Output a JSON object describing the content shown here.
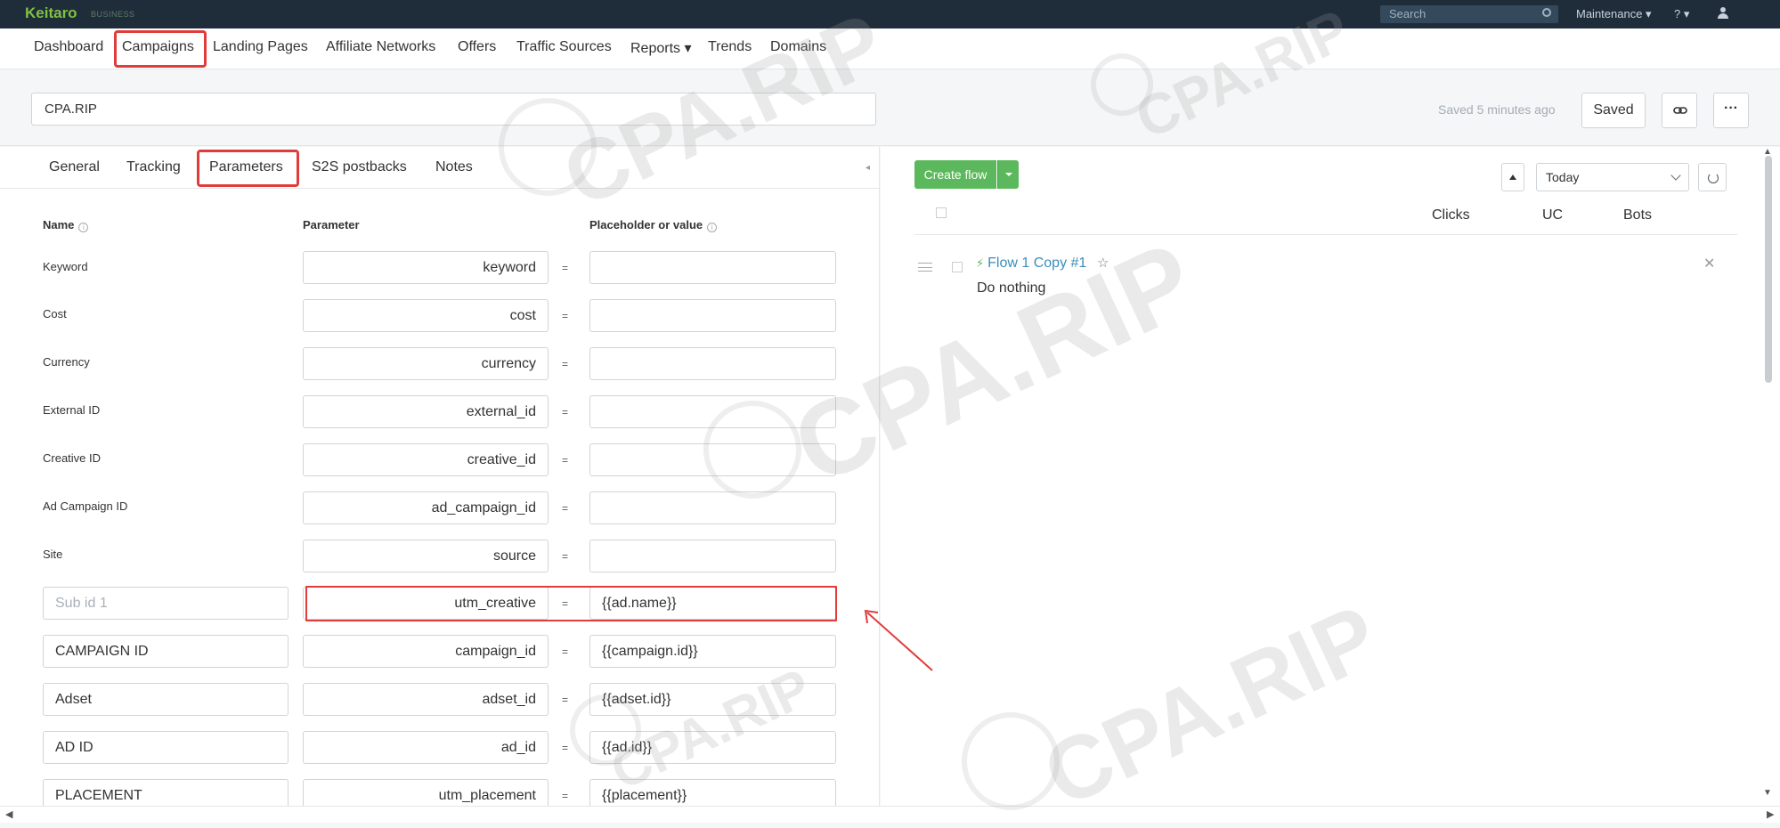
{
  "topbar": {
    "logo": "Keitaro",
    "logo_sub": "BUSINESS",
    "search_placeholder": "Search",
    "maintenance": "Maintenance ▾",
    "help": "? ▾"
  },
  "nav": {
    "items": [
      "Dashboard",
      "Campaigns",
      "Landing Pages",
      "Affiliate Networks",
      "Offers",
      "Traffic Sources",
      "Reports ▾",
      "Trends",
      "Domains"
    ]
  },
  "campaign": {
    "name": "CPA.RIP",
    "saved_status": "Saved 5 minutes ago",
    "saved_button": "Saved",
    "more_button": "···"
  },
  "tabs": [
    "General",
    "Tracking",
    "Parameters",
    "S2S postbacks",
    "Notes"
  ],
  "params": {
    "col_name": "Name",
    "col_param": "Parameter",
    "col_value": "Placeholder or value",
    "fixed_rows": [
      {
        "label": "Keyword",
        "param": "keyword",
        "value": ""
      },
      {
        "label": "Cost",
        "param": "cost",
        "value": ""
      },
      {
        "label": "Currency",
        "param": "currency",
        "value": ""
      },
      {
        "label": "External ID",
        "param": "external_id",
        "value": ""
      },
      {
        "label": "Creative ID",
        "param": "creative_id",
        "value": ""
      },
      {
        "label": "Ad Campaign ID",
        "param": "ad_campaign_id",
        "value": ""
      },
      {
        "label": "Site",
        "param": "source",
        "value": ""
      }
    ],
    "custom_rows": [
      {
        "name": "",
        "name_placeholder": "Sub id 1",
        "param": "utm_creative",
        "value": "{{ad.name}}"
      },
      {
        "name": "CAMPAIGN ID",
        "param": "campaign_id",
        "value": "{{campaign.id}}"
      },
      {
        "name": "Adset",
        "param": "adset_id",
        "value": "{{adset.id}}"
      },
      {
        "name": "AD ID",
        "param": "ad_id",
        "value": "{{ad.id}}"
      },
      {
        "name": "PLACEMENT",
        "param": "utm_placement",
        "value": "{{placement}}"
      }
    ],
    "eq": "="
  },
  "flows": {
    "create_button": "Create flow",
    "date_range": "Today",
    "columns": [
      "Clicks",
      "UC",
      "Bots"
    ],
    "items": [
      {
        "name": "Flow 1 Copy #1",
        "action": "Do nothing"
      }
    ]
  },
  "watermark": "CPA.RIP",
  "colors": {
    "topbar": "#1f2d3a",
    "brand": "#7ec242",
    "highlight": "#e03c3c",
    "create_flow": "#5cb85c",
    "link": "#3c8dbc"
  }
}
